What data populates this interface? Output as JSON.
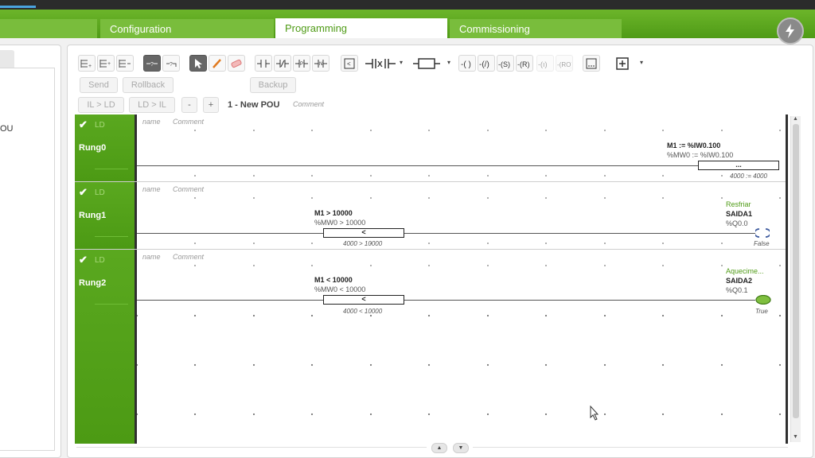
{
  "tabs": [
    {
      "label": "Configuration",
      "active": false
    },
    {
      "label": "Programming",
      "active": true
    },
    {
      "label": "Commissioning",
      "active": false
    }
  ],
  "left_panel": {
    "item_text": "OU"
  },
  "toolbar": {
    "send": "Send",
    "rollback": "Rollback",
    "backup": "Backup",
    "il_to_ld": "IL > LD",
    "ld_to_il": "LD > IL",
    "zoom_out": "-",
    "zoom_in": "+",
    "pou_title": "1 - New POU",
    "pou_comment": "Comment",
    "icons": [
      "insert-rung-icon",
      "insert-rung-below-icon",
      "delete-rung-icon",
      "comment-toggle-icon",
      "text-toggle-icon",
      "pointer-icon",
      "pencil-icon",
      "eraser-icon",
      "no-contact-icon",
      "nc-contact-icon",
      "p-contact-icon",
      "n-contact-icon",
      "compare-block-icon",
      "xor-contact-icon",
      "function-block-icon",
      "coil-icon",
      "negated-coil-icon",
      "set-coil-icon",
      "reset-coil-icon",
      "set-coil-disabled-icon",
      "reset-coil-disabled-icon",
      "operate-block-icon",
      "add-block-icon"
    ]
  },
  "rungs": [
    {
      "status": "LD",
      "name": "Rung0",
      "name_field": "name",
      "comment_field": "Comment",
      "block_title": "M1 := %IW0.100",
      "block_sub": "%MW0 := %IW0.100",
      "block_text": "...",
      "block_value": "4000 := 4000"
    },
    {
      "status": "LD",
      "name": "Rung1",
      "name_field": "name",
      "comment_field": "Comment",
      "block_title": "M1 > 10000",
      "block_sub": "%MW0 > 10000",
      "block_text": "<",
      "block_value": "4000 > 10000",
      "coil_comment": "Resfriar",
      "coil_symbol": "SAIDA1",
      "coil_address": "%Q0.0",
      "coil_state": "False"
    },
    {
      "status": "LD",
      "name": "Rung2",
      "name_field": "name",
      "comment_field": "Comment",
      "block_title": "M1 < 10000",
      "block_sub": "%MW0 < 10000",
      "block_text": "<",
      "block_value": "4000 < 10000",
      "coil_comment": "Aquecime...",
      "coil_symbol": "SAIDA2",
      "coil_address": "%Q0.1",
      "coil_state": "True"
    }
  ],
  "colors": {
    "accent": "#5aa81f",
    "coil_on": "#7fbf3f",
    "coil_off": "#3d5a9e"
  }
}
